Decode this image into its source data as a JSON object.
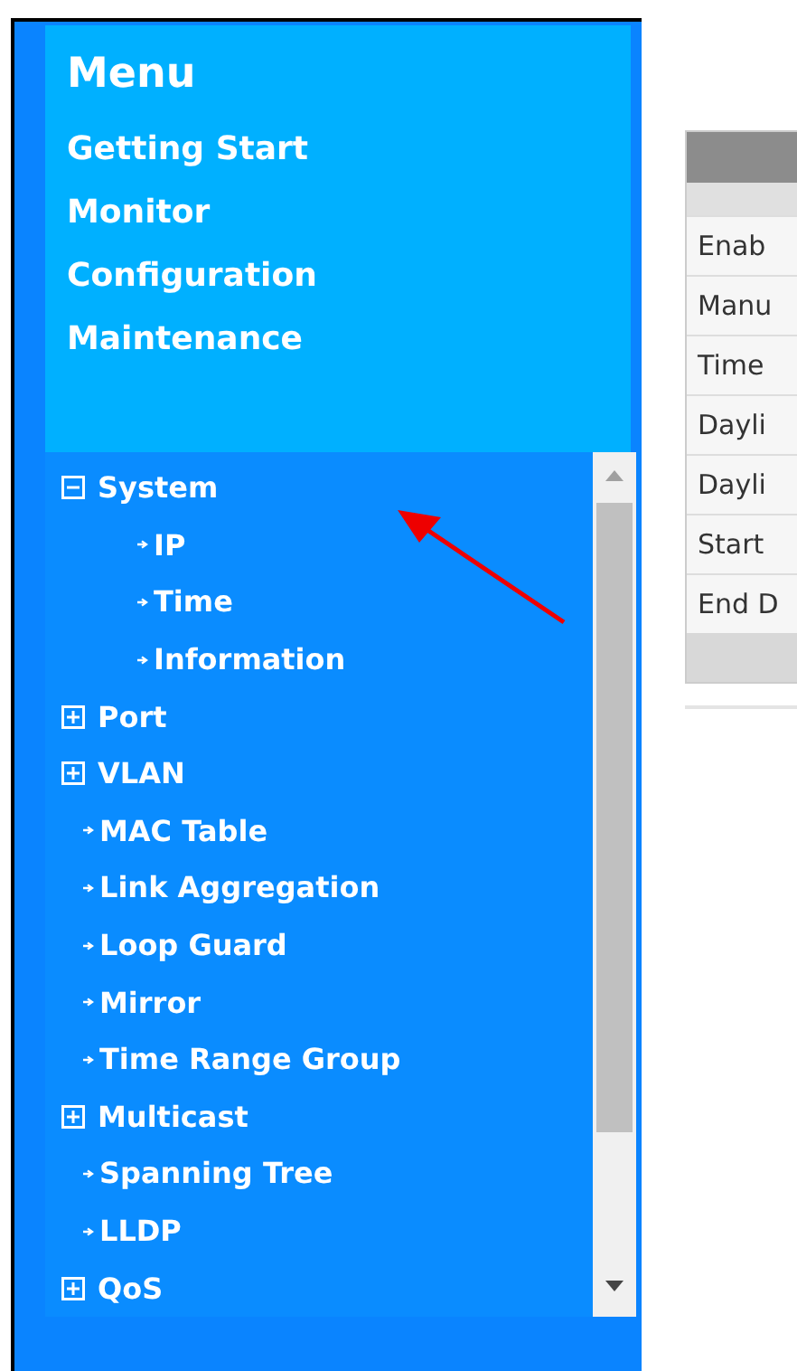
{
  "menu": {
    "title": "Menu",
    "items": [
      {
        "label": "Getting Start"
      },
      {
        "label": "Monitor"
      },
      {
        "label": "Configuration"
      },
      {
        "label": "Maintenance"
      }
    ]
  },
  "tree": [
    {
      "kind": "group",
      "label": "System",
      "expanded": true,
      "children": [
        {
          "kind": "leaf",
          "label": "IP"
        },
        {
          "kind": "leaf",
          "label": "Time"
        },
        {
          "kind": "leaf",
          "label": "Information"
        }
      ]
    },
    {
      "kind": "group",
      "label": "Port",
      "expanded": false
    },
    {
      "kind": "group",
      "label": "VLAN",
      "expanded": false
    },
    {
      "kind": "leaf",
      "label": "MAC Table"
    },
    {
      "kind": "leaf",
      "label": "Link Aggregation"
    },
    {
      "kind": "leaf",
      "label": "Loop Guard"
    },
    {
      "kind": "leaf",
      "label": "Mirror"
    },
    {
      "kind": "leaf",
      "label": "Time Range Group"
    },
    {
      "kind": "group",
      "label": "Multicast",
      "expanded": false
    },
    {
      "kind": "leaf",
      "label": "Spanning Tree"
    },
    {
      "kind": "leaf",
      "label": "LLDP"
    },
    {
      "kind": "group",
      "label": "QoS",
      "expanded": false
    }
  ],
  "table": {
    "rows": [
      "Enab",
      "Manu",
      "Time",
      "Dayli",
      "Dayli",
      "Start",
      "End D"
    ]
  }
}
